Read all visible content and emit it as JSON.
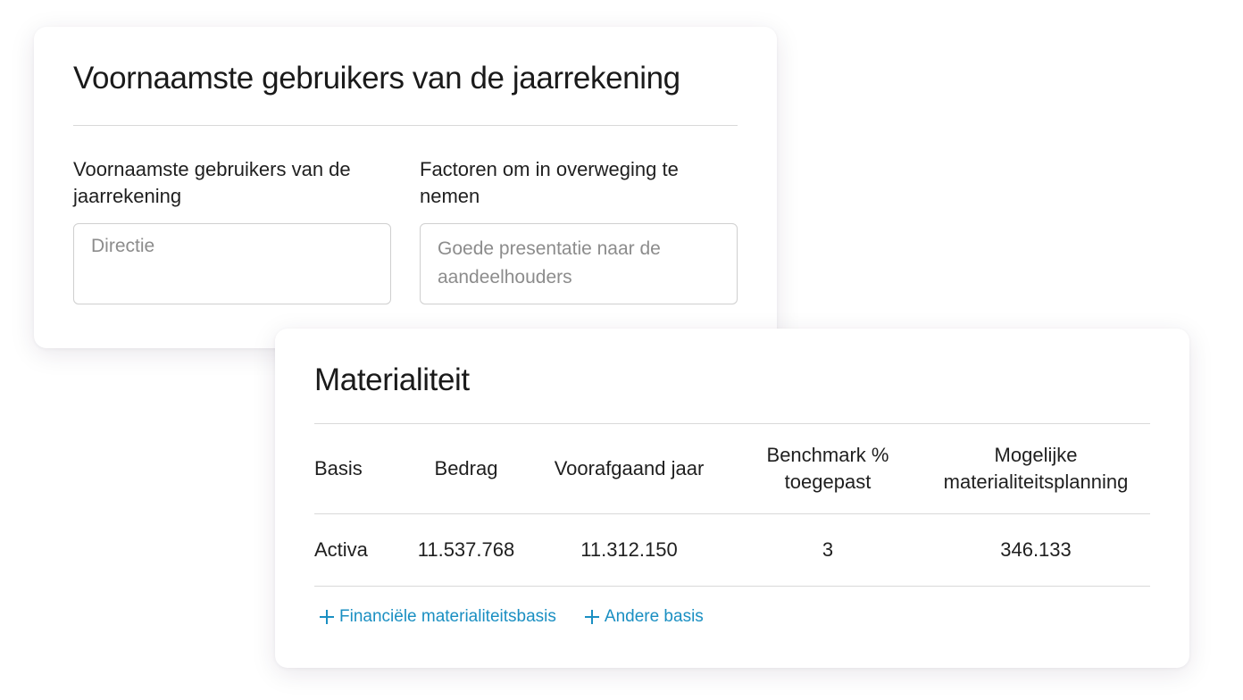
{
  "users_card": {
    "title": "Voornaamste gebruikers van de jaarrekening",
    "users_field": {
      "label": "Voornaamste gebruikers van de jaarrekening",
      "placeholder": "Directie"
    },
    "factors_field": {
      "label": "Factoren om in overweging te nemen",
      "placeholder": "Goede presentatie naar de aandeelhouders"
    }
  },
  "materiality_card": {
    "title": "Materialiteit",
    "columns": {
      "basis": "Basis",
      "amount": "Bedrag",
      "previous_year": "Voorafgaand jaar",
      "benchmark": "Benchmark % toegepast",
      "possible_planning": "Mogelijke materialiteitsplanning"
    },
    "rows": [
      {
        "basis": "Activa",
        "amount": "11.537.768",
        "previous_year": "11.312.150",
        "benchmark": "3",
        "possible_planning": "346.133"
      }
    ],
    "actions": {
      "add_financial_basis": "Financiële materialiteitsbasis",
      "add_other_basis": "Andere basis"
    }
  },
  "colors": {
    "accent": "#1a8fc2",
    "divider": "#d9d9d9",
    "text": "#1a1a1a",
    "placeholder": "#8c8c8c"
  },
  "icons": {
    "add": "plus-icon"
  }
}
